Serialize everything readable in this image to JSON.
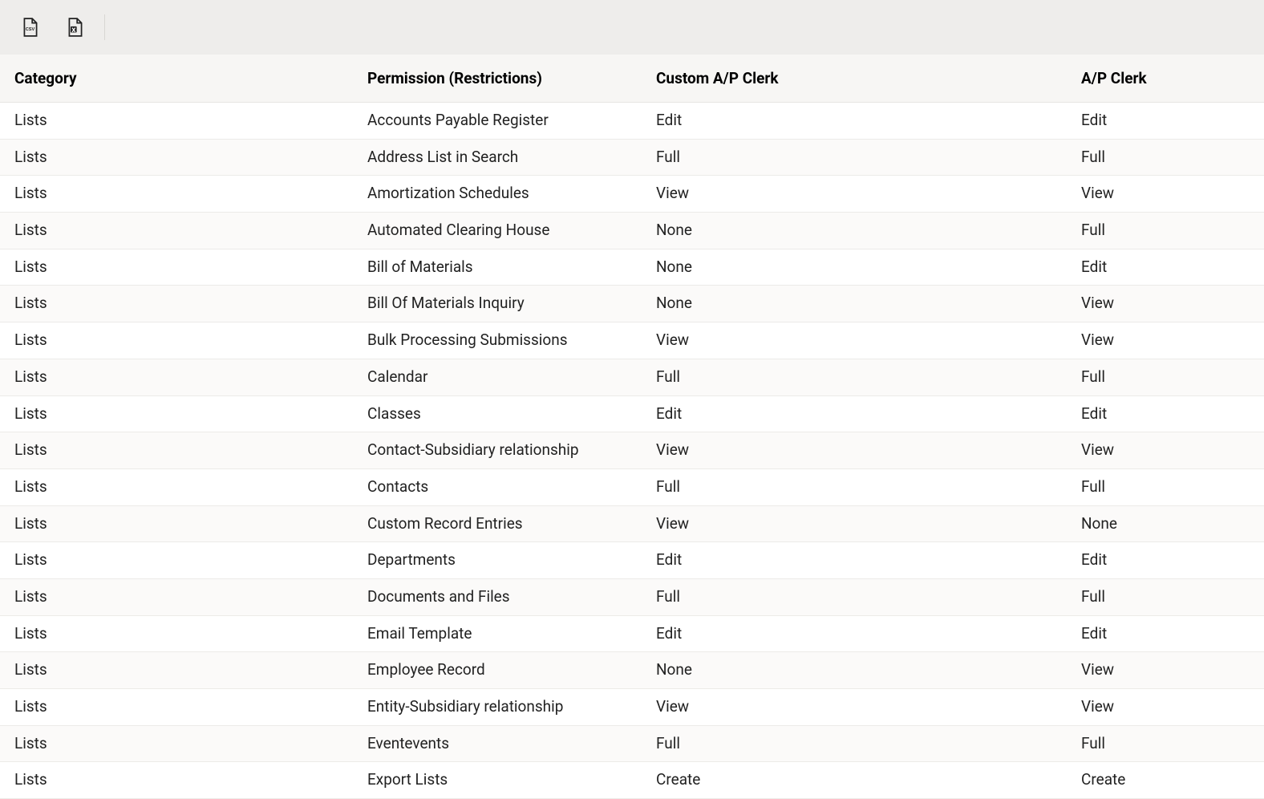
{
  "toolbar": {
    "export_csv_title": "Export CSV",
    "export_xls_title": "Export Excel"
  },
  "table": {
    "columns": [
      {
        "key": "category",
        "label": "Category"
      },
      {
        "key": "permission",
        "label": "Permission (Restrictions)"
      },
      {
        "key": "custom_ap_clerk",
        "label": "Custom A/P Clerk"
      },
      {
        "key": "ap_clerk",
        "label": "A/P Clerk"
      }
    ],
    "rows": [
      {
        "category": "Lists",
        "permission": "Accounts Payable Register",
        "custom_ap_clerk": "Edit",
        "ap_clerk": "Edit"
      },
      {
        "category": "Lists",
        "permission": "Address List in Search",
        "custom_ap_clerk": "Full",
        "ap_clerk": "Full"
      },
      {
        "category": "Lists",
        "permission": "Amortization Schedules",
        "custom_ap_clerk": "View",
        "ap_clerk": "View"
      },
      {
        "category": "Lists",
        "permission": "Automated Clearing House",
        "custom_ap_clerk": "None",
        "ap_clerk": "Full"
      },
      {
        "category": "Lists",
        "permission": "Bill of Materials",
        "custom_ap_clerk": "None",
        "ap_clerk": "Edit"
      },
      {
        "category": "Lists",
        "permission": "Bill Of Materials Inquiry",
        "custom_ap_clerk": "None",
        "ap_clerk": "View"
      },
      {
        "category": "Lists",
        "permission": "Bulk Processing Submissions",
        "custom_ap_clerk": "View",
        "ap_clerk": "View"
      },
      {
        "category": "Lists",
        "permission": "Calendar",
        "custom_ap_clerk": "Full",
        "ap_clerk": "Full"
      },
      {
        "category": "Lists",
        "permission": "Classes",
        "custom_ap_clerk": "Edit",
        "ap_clerk": "Edit"
      },
      {
        "category": "Lists",
        "permission": "Contact-Subsidiary relationship",
        "custom_ap_clerk": "View",
        "ap_clerk": "View"
      },
      {
        "category": "Lists",
        "permission": "Contacts",
        "custom_ap_clerk": "Full",
        "ap_clerk": "Full"
      },
      {
        "category": "Lists",
        "permission": "Custom Record Entries",
        "custom_ap_clerk": "View",
        "ap_clerk": "None"
      },
      {
        "category": "Lists",
        "permission": "Departments",
        "custom_ap_clerk": "Edit",
        "ap_clerk": "Edit"
      },
      {
        "category": "Lists",
        "permission": "Documents and Files",
        "custom_ap_clerk": "Full",
        "ap_clerk": "Full"
      },
      {
        "category": "Lists",
        "permission": "Email Template",
        "custom_ap_clerk": "Edit",
        "ap_clerk": "Edit"
      },
      {
        "category": "Lists",
        "permission": "Employee Record",
        "custom_ap_clerk": "None",
        "ap_clerk": "View"
      },
      {
        "category": "Lists",
        "permission": "Entity-Subsidiary relationship",
        "custom_ap_clerk": "View",
        "ap_clerk": "View"
      },
      {
        "category": "Lists",
        "permission": "Eventevents",
        "custom_ap_clerk": "Full",
        "ap_clerk": "Full"
      },
      {
        "category": "Lists",
        "permission": "Export Lists",
        "custom_ap_clerk": "Create",
        "ap_clerk": "Create"
      }
    ]
  }
}
